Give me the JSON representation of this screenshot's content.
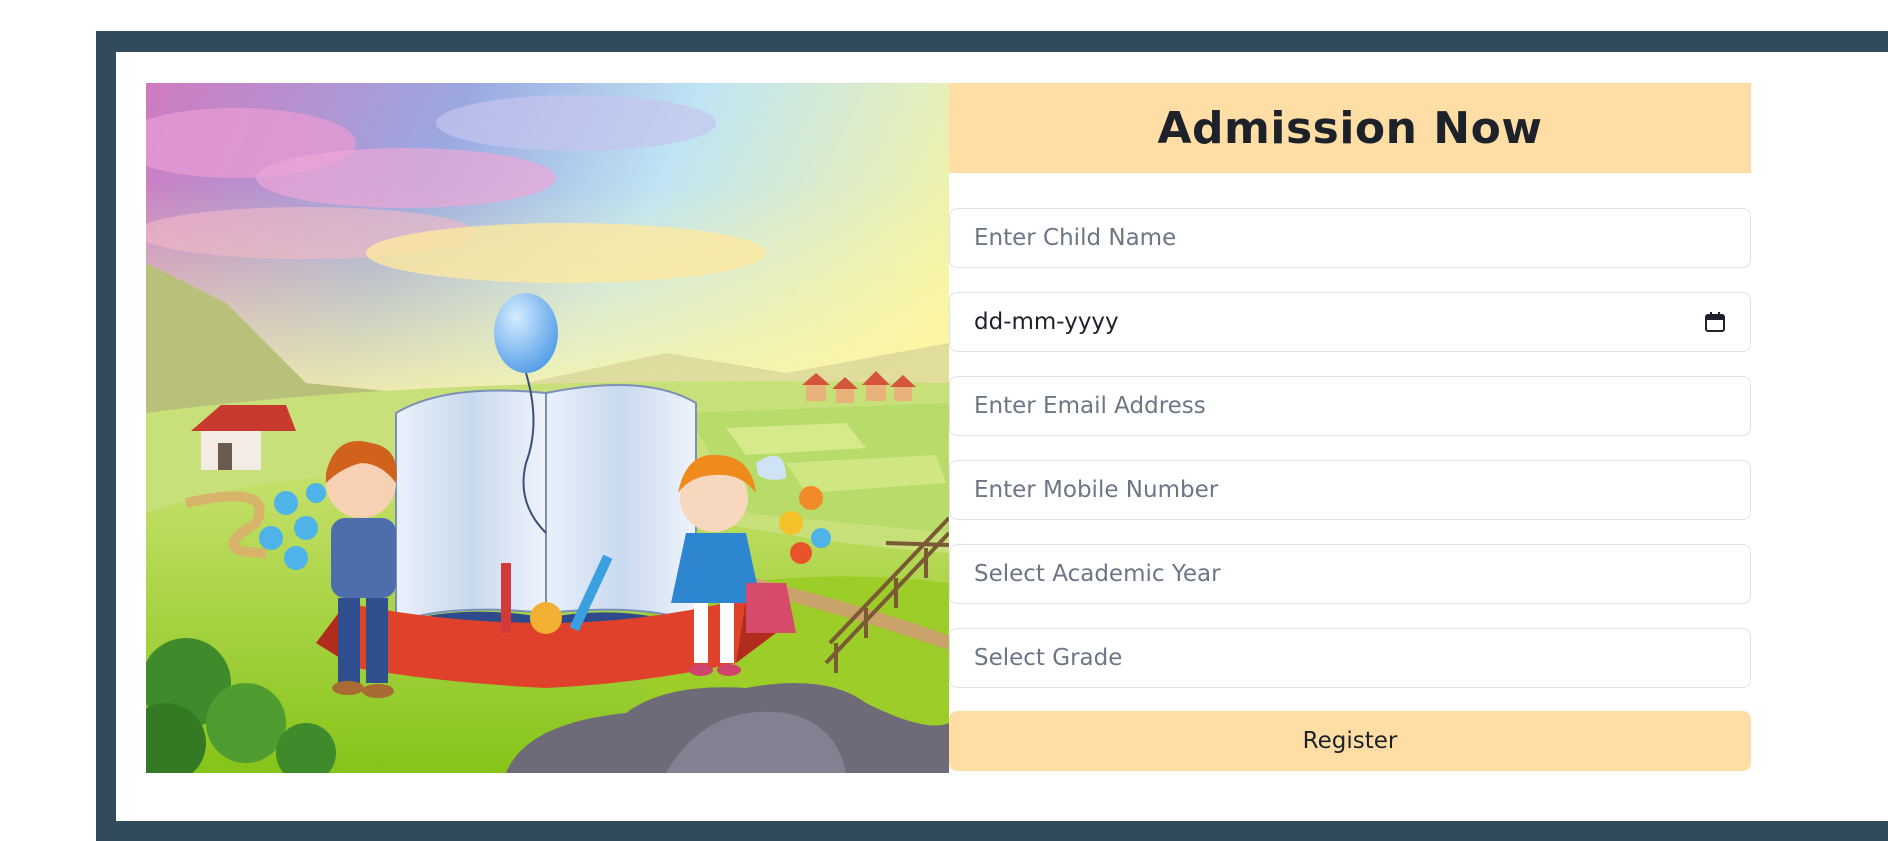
{
  "form": {
    "title": "Admission Now",
    "child_name_placeholder": "Enter Child Name",
    "date_placeholder": "dd-mm-yyyy",
    "email_placeholder": "Enter Email Address",
    "mobile_placeholder": "Enter Mobile Number",
    "academic_year_placeholder": "Select Academic Year",
    "grade_placeholder": "Select Grade",
    "register_label": "Register"
  },
  "colors": {
    "frame": "#314a5c",
    "header_bg": "#ffdea6",
    "button_bg": "#ffdea6",
    "title_text": "#1d222a",
    "placeholder_text": "#6b7686"
  },
  "icons": {
    "date_picker": "calendar-icon"
  }
}
